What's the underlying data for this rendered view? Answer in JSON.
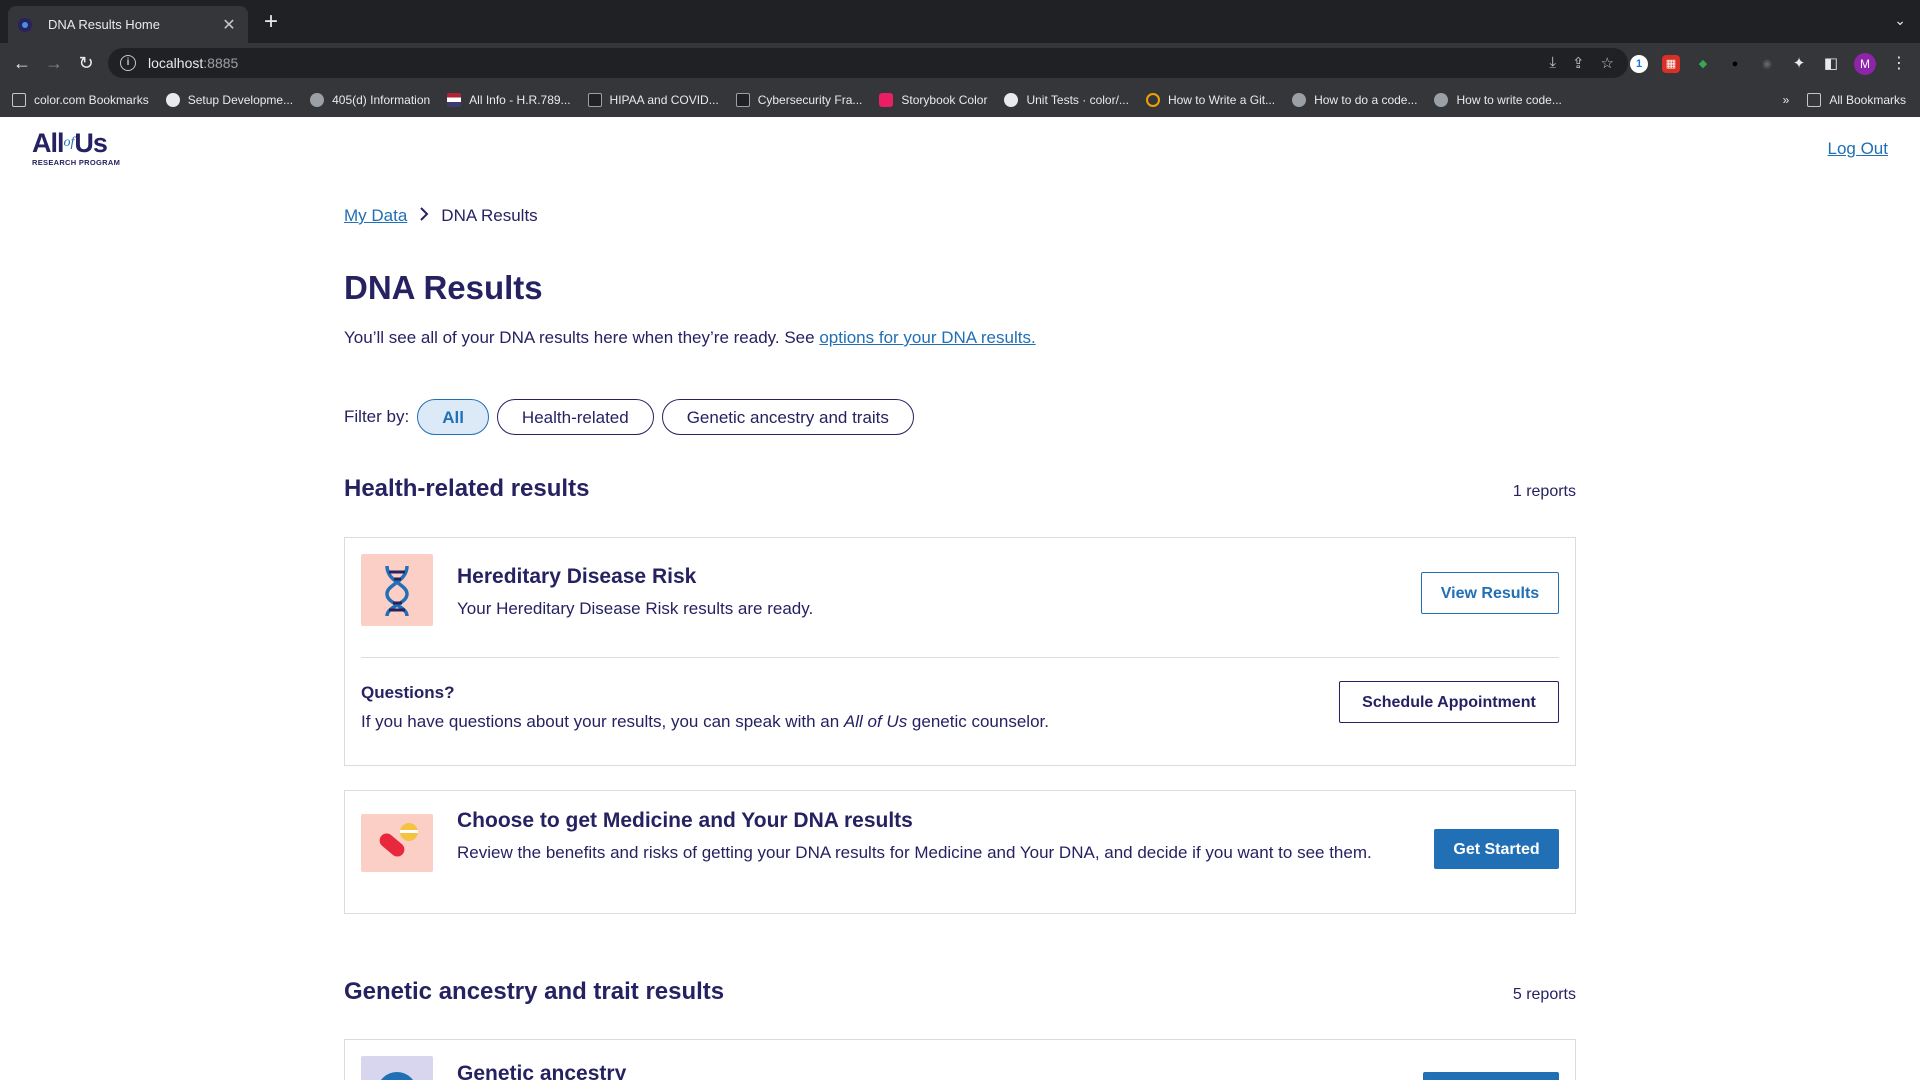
{
  "browser": {
    "tab_title": "DNA Results Home",
    "url_host": "localhost",
    "url_port": ":8885",
    "profile_initial": "M",
    "bookmarks": [
      "color.com Bookmarks",
      "Setup Developme...",
      "405(d) Information",
      "All Info - H.R.789...",
      "HIPAA and COVID...",
      "Cybersecurity Fra...",
      "Storybook Color",
      "Unit Tests · color/...",
      "How to Write a Git...",
      "How to do a code...",
      "How to write code..."
    ],
    "bookmarks_overflow": "»",
    "all_bookmarks": "All Bookmarks"
  },
  "header": {
    "logo_all": "All",
    "logo_of": "of",
    "logo_us": "Us",
    "logo_sub": "RESEARCH PROGRAM",
    "logout": "Log Out"
  },
  "breadcrumb": {
    "parent": "My Data",
    "current": "DNA Results"
  },
  "page": {
    "title": "DNA Results",
    "intro_text": "You’ll see all of your DNA results here when they’re ready. See ",
    "intro_link": "options for your DNA results."
  },
  "filters": {
    "label": "Filter by:",
    "options": [
      "All",
      "Health-related",
      "Genetic ancestry and traits"
    ],
    "selected": "All"
  },
  "health_section": {
    "title": "Health-related results",
    "count": "1 reports",
    "hdr_card": {
      "icon": "dna-icon",
      "title": "Hereditary Disease Risk",
      "description": "Your Hereditary Disease Risk results are ready.",
      "button": "View Results",
      "questions_title": "Questions?",
      "questions_pre": "If you have questions about your results, you can speak with an ",
      "questions_em": "All of Us",
      "questions_post": " genetic counselor.",
      "schedule_button": "Schedule Appointment"
    },
    "pgx_card": {
      "icon": "pills-icon",
      "title": "Choose to get Medicine and Your DNA results",
      "description": "Review the benefits and risks of getting your DNA results for Medicine and Your DNA, and decide if you want to see them.",
      "button": "Get Started"
    }
  },
  "ancestry_section": {
    "title": "Genetic ancestry and trait results",
    "count": "5 reports",
    "first_card": {
      "icon": "globe-icon",
      "title": "Genetic ancestry"
    }
  },
  "colors": {
    "navy": "#262262",
    "blue": "#216fb4",
    "icon_bg": "#fbcfc6"
  }
}
